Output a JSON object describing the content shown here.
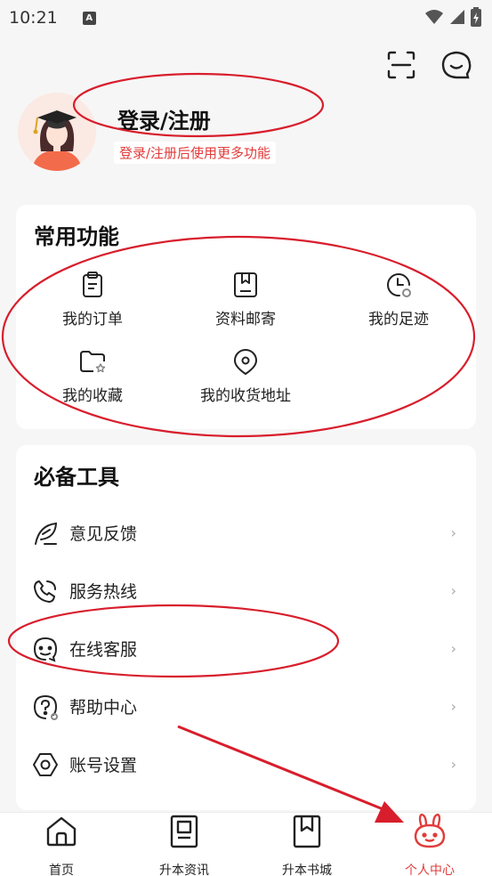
{
  "status": {
    "time": "10:21",
    "a_icon": "A"
  },
  "profile": {
    "title": "登录/注册",
    "subtitle": "登录/注册后使用更多功能"
  },
  "functions": {
    "title": "常用功能",
    "items": [
      {
        "label": "我的订单",
        "icon": "clipboard-icon"
      },
      {
        "label": "资料邮寄",
        "icon": "box-icon"
      },
      {
        "label": "我的足迹",
        "icon": "clock-icon"
      },
      {
        "label": "我的收藏",
        "icon": "folder-star-icon"
      },
      {
        "label": "我的收货地址",
        "icon": "location-pin-icon"
      }
    ]
  },
  "tools": {
    "title": "必备工具",
    "items": [
      {
        "label": "意见反馈",
        "icon": "leaf-feedback-icon"
      },
      {
        "label": "服务热线",
        "icon": "phone-icon"
      },
      {
        "label": "在线客服",
        "icon": "chat-face-icon"
      },
      {
        "label": "帮助中心",
        "icon": "help-icon"
      },
      {
        "label": "账号设置",
        "icon": "hexagon-settings-icon"
      }
    ],
    "chevron": "›"
  },
  "tabs": [
    {
      "label": "首页",
      "icon": "home-icon"
    },
    {
      "label": "升本资讯",
      "icon": "news-icon"
    },
    {
      "label": "升本书城",
      "icon": "bookmark-book-icon"
    },
    {
      "label": "个人中心",
      "icon": "bunny-icon"
    }
  ],
  "colors": {
    "accent": "#e23b3b",
    "annotation": "#d81e2c"
  }
}
